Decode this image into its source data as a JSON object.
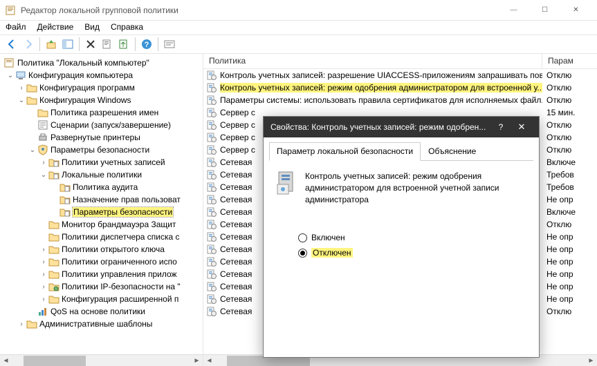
{
  "window": {
    "title": "Редактор локальной групповой политики",
    "min": "—",
    "max": "☐",
    "close": "✕"
  },
  "menu": [
    "Файл",
    "Действие",
    "Вид",
    "Справка"
  ],
  "tree": {
    "root": "Политика \"Локальный компьютер\"",
    "nodes": [
      {
        "indent": 0,
        "exp": "open",
        "icon": "computer",
        "label": "Конфигурация компьютера"
      },
      {
        "indent": 1,
        "exp": "closed",
        "icon": "folder",
        "label": "Конфигурация программ"
      },
      {
        "indent": 1,
        "exp": "open",
        "icon": "folder",
        "label": "Конфигурация Windows"
      },
      {
        "indent": 2,
        "exp": "none",
        "icon": "folder",
        "label": "Политика разрешения имен"
      },
      {
        "indent": 2,
        "exp": "none",
        "icon": "script",
        "label": "Сценарии (запуск/завершение)"
      },
      {
        "indent": 2,
        "exp": "none",
        "icon": "printer",
        "label": "Развернутые принтеры"
      },
      {
        "indent": 2,
        "exp": "open",
        "icon": "shield",
        "label": "Параметры безопасности"
      },
      {
        "indent": 3,
        "exp": "closed",
        "icon": "folder-doc",
        "label": "Политики учетных записей"
      },
      {
        "indent": 3,
        "exp": "open",
        "icon": "folder-doc",
        "label": "Локальные политики"
      },
      {
        "indent": 4,
        "exp": "none",
        "icon": "folder-doc",
        "label": "Политика аудита"
      },
      {
        "indent": 4,
        "exp": "none",
        "icon": "folder-doc",
        "label": "Назначение прав пользоват"
      },
      {
        "indent": 4,
        "exp": "none",
        "icon": "folder-doc",
        "label": "Параметры безопасности",
        "sel": true
      },
      {
        "indent": 3,
        "exp": "none",
        "icon": "folder",
        "label": "Монитор брандмауэра Защит"
      },
      {
        "indent": 3,
        "exp": "none",
        "icon": "folder",
        "label": "Политики диспетчера списка с"
      },
      {
        "indent": 3,
        "exp": "closed",
        "icon": "folder",
        "label": "Политики открытого ключа"
      },
      {
        "indent": 3,
        "exp": "closed",
        "icon": "folder",
        "label": "Политики ограниченного испо"
      },
      {
        "indent": 3,
        "exp": "closed",
        "icon": "folder",
        "label": "Политики управления прилож"
      },
      {
        "indent": 3,
        "exp": "closed",
        "icon": "folder-net",
        "label": "Политики IP-безопасности на \""
      },
      {
        "indent": 3,
        "exp": "closed",
        "icon": "folder",
        "label": "Конфигурация расширенной п"
      },
      {
        "indent": 2,
        "exp": "none",
        "icon": "qos",
        "label": "QoS на основе политики"
      },
      {
        "indent": 1,
        "exp": "closed",
        "icon": "folder",
        "label": "Административные шаблоны"
      }
    ]
  },
  "list": {
    "head": {
      "c1": "Политика",
      "c2": "Парам"
    },
    "rows": [
      {
        "t": "Контроль учетных записей: разрешение UIACCESS-приложениям запрашивать повы...",
        "v": "Отклю"
      },
      {
        "t": "Контроль учетных записей: режим одобрения администратором для встроенной у...",
        "v": "Отклю",
        "sel": true
      },
      {
        "t": "Параметры системы: использовать правила сертификатов для исполняемых файл...",
        "v": "Отклю"
      },
      {
        "t": "Сервер с",
        "v": "15 мин."
      },
      {
        "t": "Сервер с",
        "v": "Отклю"
      },
      {
        "t": "Сервер с",
        "v": "Отклю"
      },
      {
        "t": "Сервер с",
        "v": "Отклю"
      },
      {
        "t": "Сетевая",
        "v": "Включе"
      },
      {
        "t": "Сетевая",
        "v": "Требов"
      },
      {
        "t": "Сетевая",
        "v": "Требов"
      },
      {
        "t": "Сетевая",
        "v": "Не опр"
      },
      {
        "t": "Сетевая",
        "v": "Включе"
      },
      {
        "t": "Сетевая",
        "v": "Отклю"
      },
      {
        "t": "Сетевая",
        "v": "Не опр"
      },
      {
        "t": "Сетевая",
        "v": "Не опр"
      },
      {
        "t": "Сетевая",
        "v": "Не опр"
      },
      {
        "t": "Сетевая",
        "v": "Не опр"
      },
      {
        "t": "Сетевая",
        "v": "Не опр"
      },
      {
        "t": "Сетевая",
        "v": "Не опр"
      },
      {
        "t": "Сетевая",
        "v": "Отклю"
      }
    ]
  },
  "dialog": {
    "title": "Свойства: Контроль учетных записей: режим одобрен...",
    "help": "?",
    "close": "✕",
    "tabs": [
      "Параметр локальной безопасности",
      "Объяснение"
    ],
    "desc": "Контроль учетных записей: режим одобрения администратором для встроенной учетной записи администратора",
    "radio_on": "Включен",
    "radio_off": "Отключен"
  }
}
